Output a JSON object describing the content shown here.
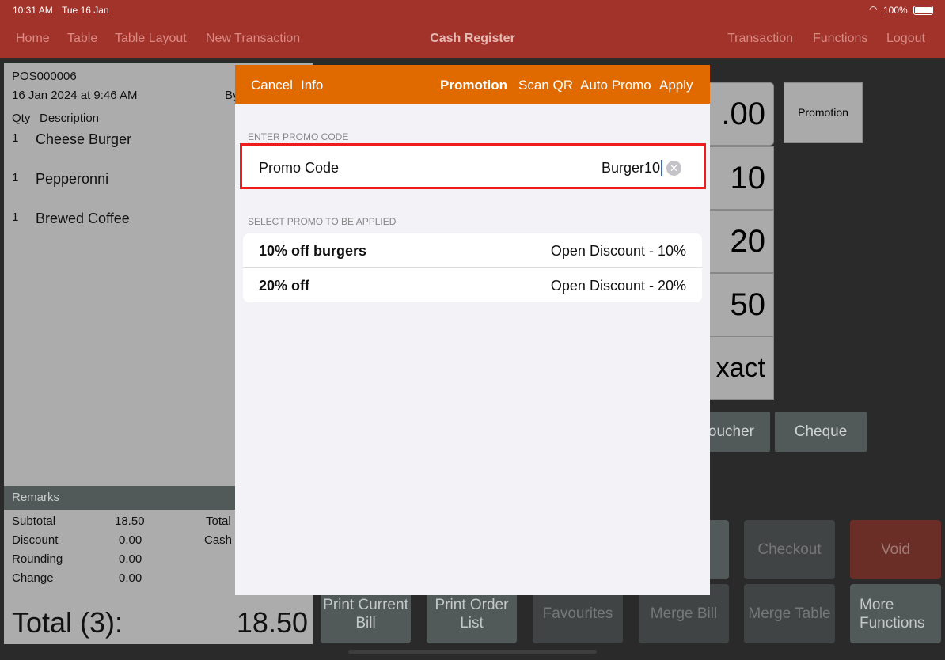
{
  "status": {
    "time": "10:31 AM",
    "date": "Tue 16 Jan",
    "battery": "100%",
    "wifi_icon": "wifi-icon",
    "battery_icon": "battery-icon"
  },
  "nav": {
    "left": [
      "Home",
      "Table",
      "Table Layout",
      "New Transaction"
    ],
    "title": "Cash Register",
    "right": [
      "Transaction",
      "Functions",
      "Logout"
    ]
  },
  "receipt": {
    "id": "POS000006",
    "datetime": "16 Jan 2024 at 9:46 AM",
    "by": "By",
    "qty_header": "Qty",
    "desc_header": "Description",
    "items": [
      {
        "qty": "1",
        "name": "Cheese Burger"
      },
      {
        "qty": "1",
        "name": "Pepperonni"
      },
      {
        "qty": "1",
        "name": "Brewed Coffee"
      }
    ],
    "remarks": "Remarks",
    "summary": [
      {
        "label": "Subtotal",
        "value": "18.50"
      },
      {
        "label": "Discount",
        "value": "0.00"
      },
      {
        "label": "Rounding",
        "value": "0.00"
      },
      {
        "label": "Change",
        "value": "0.00"
      }
    ],
    "right_labels": [
      "Total",
      "Cash"
    ],
    "total_label": "Total (3):",
    "total_value": "18.50"
  },
  "amounts": [
    ".00",
    "10",
    "20",
    "50",
    "xact"
  ],
  "promotion_button": "Promotion",
  "payment": [
    "oucher",
    "Cheque"
  ],
  "actions_row1": [
    "",
    "Checkout",
    "Void"
  ],
  "actions_row2": [
    "Print Current Bill",
    "Print Order List",
    "Favourites",
    "Merge Bill",
    "Merge Table",
    "More Functions"
  ],
  "modal": {
    "cancel": "Cancel",
    "info": "Info",
    "title": "Promotion",
    "scan_qr": "Scan QR",
    "auto_promo": "Auto Promo",
    "apply": "Apply",
    "enter_section": "ENTER PROMO CODE",
    "promo_label": "Promo Code",
    "promo_value": "Burger10",
    "select_section": "SELECT PROMO TO BE APPLIED",
    "promos": [
      {
        "name": "10% off burgers",
        "type": "Open Discount - 10%"
      },
      {
        "name": "20% off",
        "type": "Open Discount - 20%"
      }
    ]
  },
  "colors": {
    "header": "#a2332b",
    "modal_header": "#e06a00",
    "highlight": "#ee1c1c",
    "void": "#6b2e27"
  }
}
